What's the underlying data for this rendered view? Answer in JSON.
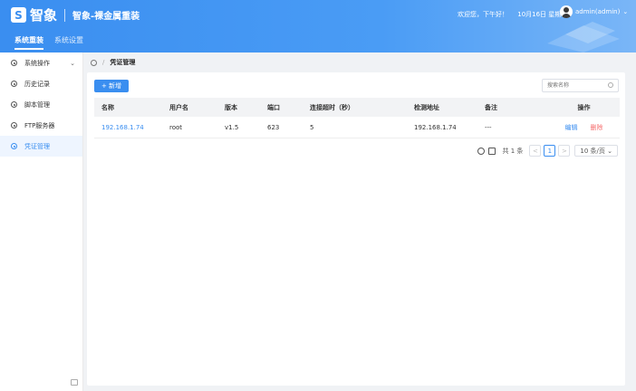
{
  "header": {
    "logo_text": "智象",
    "app_title": "智象-裸金属重装",
    "greeting": "欢迎您，下午好！",
    "date": "10月16日 星期一",
    "user": "admin(admin)",
    "user_chevron": "⌄",
    "tabs": [
      {
        "label": "系统重装",
        "active": true
      },
      {
        "label": "系统设置",
        "active": false
      }
    ]
  },
  "sidebar": {
    "items": [
      {
        "label": "系统操作",
        "icon": "gear-icon",
        "expandable": true,
        "chevron": "⌄"
      },
      {
        "label": "历史记录",
        "icon": "gear-icon"
      },
      {
        "label": "脚本管理",
        "icon": "gear-icon"
      },
      {
        "label": "FTP服务器",
        "icon": "gear-icon"
      },
      {
        "label": "凭证管理",
        "icon": "gear-icon",
        "active": true
      }
    ]
  },
  "breadcrumb": {
    "separator": "/",
    "current": "凭证管理"
  },
  "toolbar": {
    "add_label": "+ 新增",
    "search_placeholder": "搜索名称"
  },
  "table": {
    "columns": [
      "名称",
      "用户名",
      "版本",
      "端口",
      "连接超时（秒）",
      "检测地址",
      "备注",
      "操作"
    ],
    "rows": [
      {
        "name": "192.168.1.74",
        "username": "root",
        "version": "v1.5",
        "port": "623",
        "timeout": "5",
        "check_address": "192.168.1.74",
        "remark": "---",
        "edit": "编辑",
        "delete": "删除"
      }
    ]
  },
  "pagination": {
    "total": "共 1 条",
    "prev": "<",
    "current_page": "1",
    "next": ">",
    "page_size": "10 条/页 ⌄"
  },
  "colors": {
    "primary": "#3a8ef0",
    "danger": "#f56c6c"
  }
}
